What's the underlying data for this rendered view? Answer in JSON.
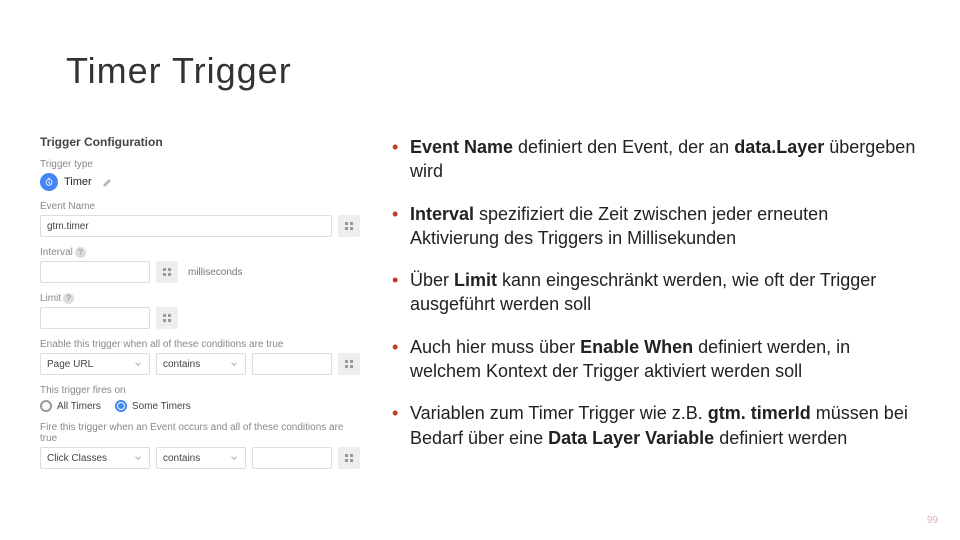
{
  "title": "Timer Trigger",
  "pageNumber": "99",
  "screenshot": {
    "header": "Trigger Configuration",
    "typeLabel": "Trigger type",
    "timerLabel": "Timer",
    "eventNameLabel": "Event Name",
    "eventNameValue": "gtm.timer",
    "intervalLabel": "Interval",
    "intervalUnit": "milliseconds",
    "limitLabel": "Limit",
    "enableLabel": "Enable this trigger when all of these conditions are true",
    "cond1Var": "Page URL",
    "cond1Op": "contains",
    "firesLabel": "This trigger fires on",
    "radioAll": "All Timers",
    "radioSome": "Some Timers",
    "fireWhenLabel": "Fire this trigger when an Event occurs and all of these conditions are true",
    "cond2Var": "Click Classes",
    "cond2Op": "contains"
  },
  "bullets": {
    "b1a": "Event Name",
    "b1b": " definiert den Event, der an ",
    "b1c": "data.Layer",
    "b1d": " übergeben wird",
    "b2a": "Interval",
    "b2b": " spezifiziert die Zeit zwischen jeder erneuten Aktivierung des Triggers in Millisekunden",
    "b3a": "Über ",
    "b3b": "Limit",
    "b3c": " kann eingeschränkt werden, wie oft der Trigger ausgeführt werden soll",
    "b4a": "Auch hier muss über ",
    "b4b": "Enable When",
    "b4c": " definiert werden, in welchem Kontext der Trigger aktiviert werden soll",
    "b5a": "Variablen zum Timer Trigger wie z.B. ",
    "b5b": "gtm. timerId",
    "b5c": " müssen bei Bedarf über eine ",
    "b5d": "Data Layer Variable",
    "b5e": " definiert werden"
  }
}
